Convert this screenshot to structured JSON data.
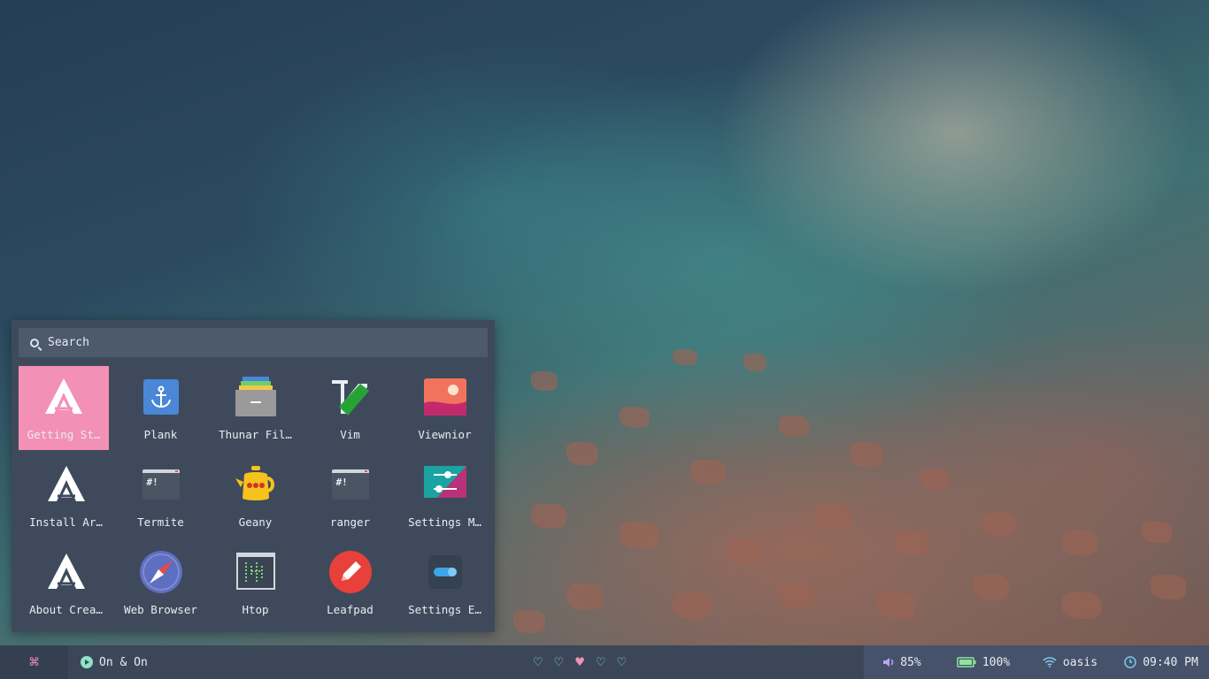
{
  "launcher": {
    "search_placeholder": "Search",
    "apps": [
      {
        "label": "Getting St…",
        "icon": "arch-logo-icon",
        "selected": true
      },
      {
        "label": "Plank",
        "icon": "anchor-icon"
      },
      {
        "label": "Thunar Fil…",
        "icon": "file-manager-icon"
      },
      {
        "label": "Vim",
        "icon": "vim-icon"
      },
      {
        "label": "Viewnior",
        "icon": "image-viewer-icon"
      },
      {
        "label": "Install Ar…",
        "icon": "arch-logo-icon"
      },
      {
        "label": "Termite",
        "icon": "terminal-icon"
      },
      {
        "label": "Geany",
        "icon": "teapot-icon"
      },
      {
        "label": "ranger",
        "icon": "terminal-icon"
      },
      {
        "label": "Settings M…",
        "icon": "settings-manager-icon"
      },
      {
        "label": "About Crea…",
        "icon": "arch-logo-icon"
      },
      {
        "label": "Web Browser",
        "icon": "compass-icon"
      },
      {
        "label": "Htop",
        "icon": "htop-icon"
      },
      {
        "label": "Leafpad",
        "icon": "pencil-icon"
      },
      {
        "label": "Settings E…",
        "icon": "toggle-icon"
      }
    ]
  },
  "panel": {
    "menu_glyph": "⌘",
    "now_playing": "On & On",
    "workspaces": [
      "♡",
      "♡",
      "♥",
      "♡",
      "♡"
    ],
    "active_workspace": 3,
    "volume": "85%",
    "battery": "100%",
    "network": "oasis",
    "clock": "09:40 PM"
  },
  "colors": {
    "accent": "#f390b6",
    "panel_bg": "#3b4759",
    "launcher_bg": "#3e4a5c",
    "icon_accent": "#8fd3e8"
  }
}
